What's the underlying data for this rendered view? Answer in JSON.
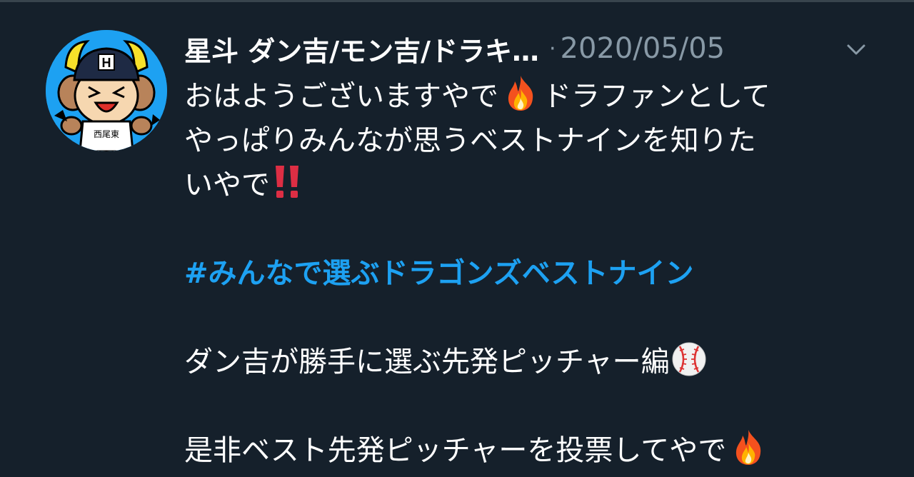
{
  "tweet": {
    "display_name": "星斗 ダン吉/モン吉/ドラキ…",
    "separator": "·",
    "timestamp": "2020/05/05",
    "text": {
      "line1_a": "おはようございますやで",
      "line1_b": "ドラファンとして",
      "line2": "やっぱりみんなが思うベストナインを知りた",
      "line3": "いやで",
      "hashtag": "#みんなで選ぶドラゴンズベストナイン",
      "line5": "ダン吉が勝手に選ぶ先発ピッチャー編",
      "line6": "是非ベスト先発ピッチャーを投票してやで"
    },
    "emojis": [
      "fire-emoji",
      "double-exclamation-emoji",
      "baseball-emoji",
      "fire-emoji"
    ],
    "avatar_badge_letter": "H",
    "avatar_shirt_text": "西尾東"
  },
  "icons": {
    "caret": "chevron-down-icon"
  },
  "colors": {
    "background": "#15202b",
    "text": "#ffffff",
    "muted": "#8899a6",
    "link": "#1da1f2",
    "divider": "#38444d"
  }
}
